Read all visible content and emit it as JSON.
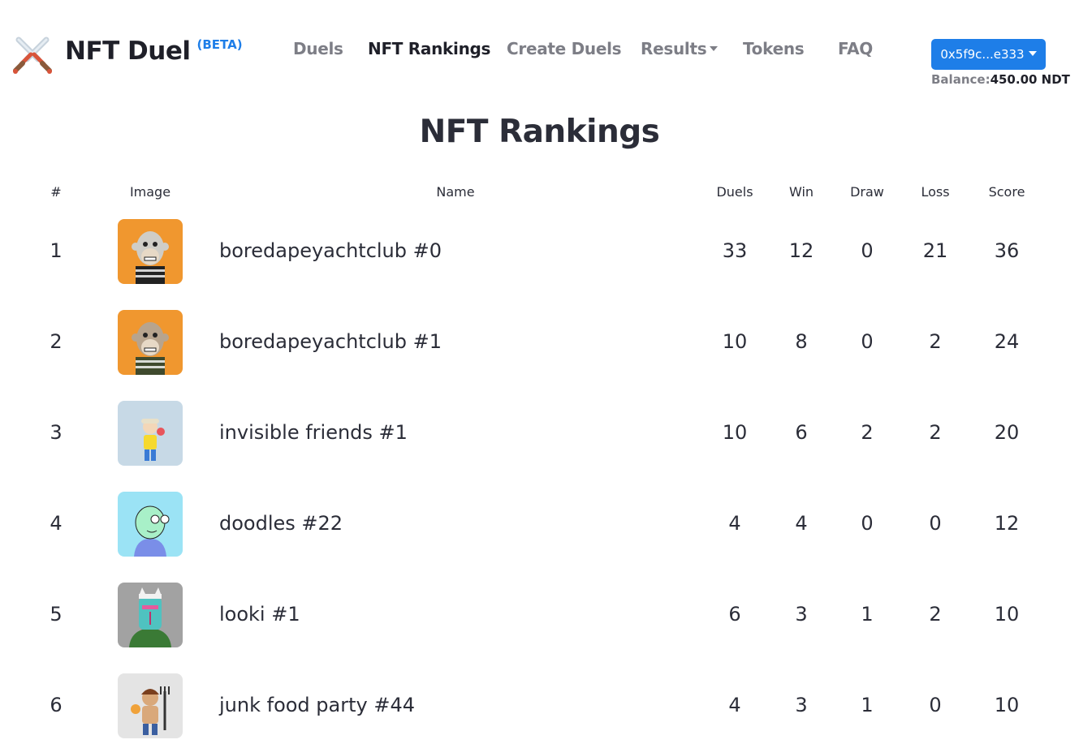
{
  "navbar": {
    "brand": "NFT Duel",
    "beta": "(BETA)",
    "links": [
      {
        "label": "Duels"
      },
      {
        "label": "NFT Rankings"
      },
      {
        "label": "Create Duels"
      },
      {
        "label": "Results"
      },
      {
        "label": "Tokens"
      },
      {
        "label": "FAQ"
      }
    ],
    "active": "NFT Rankings",
    "wallet": "0x5f9c...e333",
    "balance_label": "Balance:",
    "balance_value": "450.00 NDT"
  },
  "page": {
    "title": "NFT Rankings"
  },
  "table": {
    "headers": [
      "#",
      "Image",
      "Name",
      "Duels",
      "Win",
      "Draw",
      "Loss",
      "Score"
    ],
    "rows": [
      {
        "rank": "1",
        "name": "boredapeyachtclub #0",
        "duels": "33",
        "win": "12",
        "draw": "0",
        "loss": "21",
        "score": "36",
        "image": {
          "bg": "#f0972f",
          "kind": "ape",
          "subject": "#cfcdc7",
          "accent": "#222222"
        }
      },
      {
        "rank": "2",
        "name": "boredapeyachtclub #1",
        "duels": "10",
        "win": "8",
        "draw": "0",
        "loss": "2",
        "score": "24",
        "image": {
          "bg": "#f0972f",
          "kind": "ape",
          "subject": "#b7a48e",
          "accent": "#3f4a2d"
        }
      },
      {
        "rank": "3",
        "name": "invisible friends #1",
        "duels": "10",
        "win": "6",
        "draw": "2",
        "loss": "2",
        "score": "20",
        "image": {
          "bg": "#c7d9e6",
          "kind": "figure",
          "subject": "#f6d92e",
          "accent": "#3a7bd5"
        }
      },
      {
        "rank": "4",
        "name": "doodles #22",
        "duels": "4",
        "win": "4",
        "draw": "0",
        "loss": "0",
        "score": "12",
        "image": {
          "bg": "#9be3f5",
          "kind": "doodle",
          "subject": "#a8f0c8",
          "accent": "#7a8ee8"
        }
      },
      {
        "rank": "5",
        "name": "looki #1",
        "duels": "6",
        "win": "3",
        "draw": "1",
        "loss": "2",
        "score": "10",
        "image": {
          "bg": "#a2a2a2",
          "kind": "looki",
          "subject": "#4fc2c0",
          "accent": "#3a7a35"
        }
      },
      {
        "rank": "6",
        "name": "junk food party #44",
        "duels": "4",
        "win": "3",
        "draw": "1",
        "loss": "0",
        "score": "10",
        "image": {
          "bg": "#e4e4e4",
          "kind": "junk",
          "subject": "#d9a87a",
          "accent": "#333333"
        }
      }
    ]
  }
}
